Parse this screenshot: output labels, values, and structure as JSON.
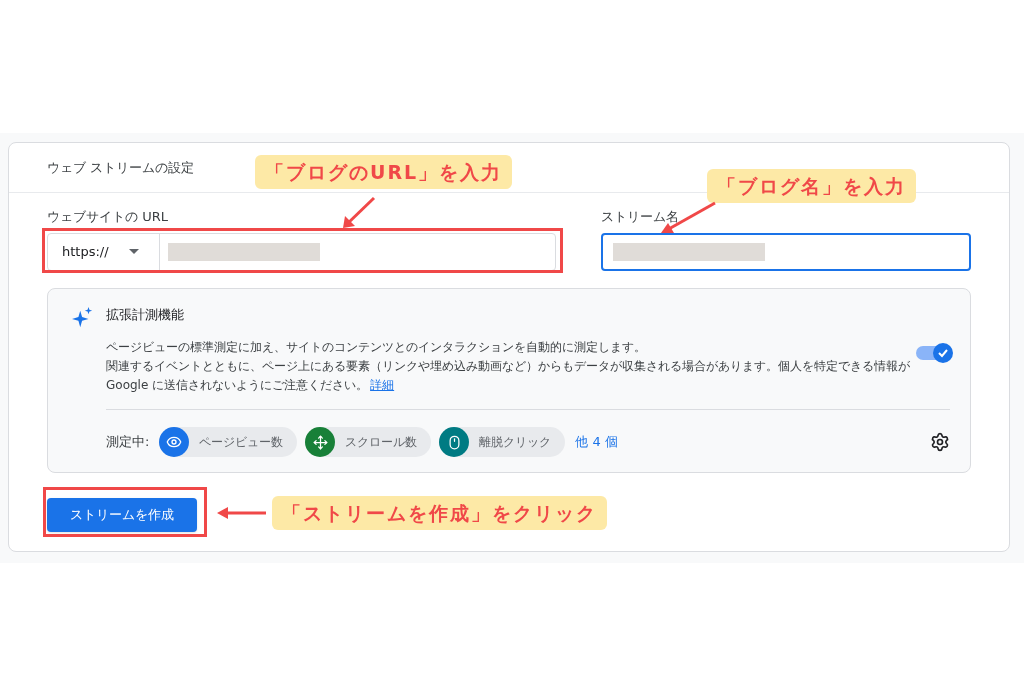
{
  "card_title": "ウェブ ストリームの設定",
  "url_field": {
    "label": "ウェブサイトの URL",
    "protocol": "https://",
    "focused": false
  },
  "stream_name_field": {
    "label": "ストリーム名",
    "focused": true
  },
  "enhanced_measurement": {
    "title": "拡張計測機能",
    "description_lines": [
      "ページビューの標準測定に加え、サイトのコンテンツとのインタラクションを自動的に測定します。",
      "関連するイベントとともに、ページ上にある要素（リンクや埋め込み動画など）からもデータが収集される場合があります。個人を特定できる情報が",
      "Google に送信されないようにご注意ください。"
    ],
    "link": "詳細",
    "on": true,
    "measuring_label": "測定中:",
    "events": [
      {
        "label": "ページビュー数",
        "kind": "eye",
        "color": "#1a73e8"
      },
      {
        "label": "スクロール数",
        "kind": "scroll",
        "color": "#188038"
      },
      {
        "label": "離脱クリック",
        "kind": "mouse",
        "color": "#007b83"
      }
    ],
    "more": "他 4 個"
  },
  "create_button": "ストリームを作成",
  "annotations": [
    {
      "text": "「ブログのURL」を入力"
    },
    {
      "text": "「ブログ名」を入力"
    },
    {
      "text": "「ストリームを作成」をクリック"
    }
  ]
}
